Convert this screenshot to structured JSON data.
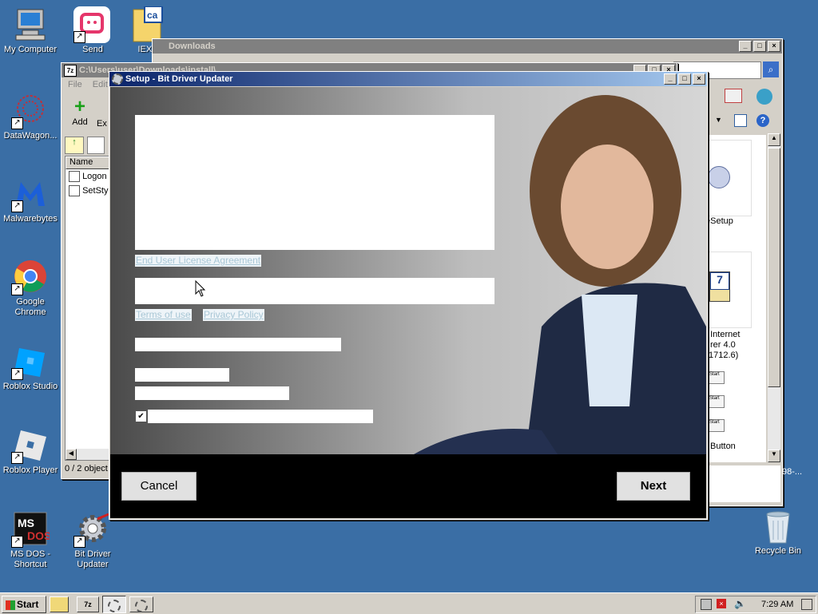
{
  "desktop": {
    "icons": [
      {
        "label": "My Computer"
      },
      {
        "label": "Send"
      },
      {
        "label": "IEXP"
      },
      {
        "label": "DataWagon..."
      },
      {
        "label": "Malwarebytes"
      },
      {
        "label": "Google Chrome"
      },
      {
        "label": "Roblox Studio"
      },
      {
        "label": "Roblox Player"
      },
      {
        "label": "MS DOS - Shortcut"
      },
      {
        "label": "Bit Driver Updater"
      },
      {
        "label": "Recycle Bin"
      }
    ],
    "shortcut_arrow": "↗"
  },
  "downloads_window": {
    "title": "Downloads",
    "items": [
      "eSetup",
      "t Internet",
      "rer 4.0",
      "1712.6)",
      "Button",
      "98-..."
    ],
    "start_labels": [
      "Start",
      "Start",
      "Start"
    ]
  },
  "sevenzip_window": {
    "title": "C:\\Users\\user\\Downloads\\install\\...",
    "menu": [
      "File",
      "Edit"
    ],
    "toolbar": [
      "Add",
      "Ex"
    ],
    "column_name": "Name",
    "files": [
      "Logon",
      "SetSty"
    ],
    "status": "0 / 2 object"
  },
  "setup_window": {
    "title": "Setup - Bit Driver Updater",
    "links": {
      "eula": "End User License Agreement",
      "terms": "Terms of use",
      "privacy": "Privacy Policy"
    },
    "checkbox_checked": true,
    "check_mark": "✔",
    "cancel_label": "Cancel",
    "next_label": "Next"
  },
  "taskbar": {
    "start_label": "Start",
    "time": "7:29 AM"
  }
}
